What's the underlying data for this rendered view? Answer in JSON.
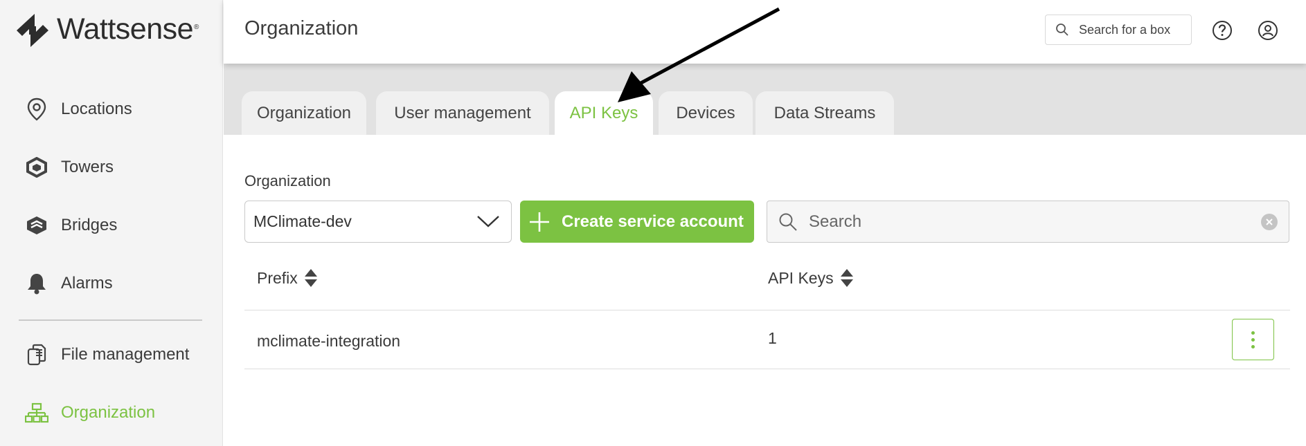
{
  "app": {
    "brand_name": "Wattsense",
    "brand_reg": "®",
    "accent_color": "#7cc242"
  },
  "sidebar": {
    "items": [
      {
        "label": "Locations",
        "icon": "location-pin-icon"
      },
      {
        "label": "Towers",
        "icon": "towers-icon"
      },
      {
        "label": "Bridges",
        "icon": "bridges-icon"
      },
      {
        "label": "Alarms",
        "icon": "bell-icon"
      },
      {
        "label": "File management",
        "icon": "files-icon"
      },
      {
        "label": "Organization",
        "icon": "org-chart-icon",
        "active": true
      }
    ]
  },
  "header": {
    "title": "Organization",
    "box_search_placeholder": "Search for a box",
    "icons": [
      "help-icon",
      "account-icon"
    ]
  },
  "tabs": [
    {
      "label": "Organization"
    },
    {
      "label": "User management"
    },
    {
      "label": "API Keys",
      "active": true
    },
    {
      "label": "Devices"
    },
    {
      "label": "Data Streams"
    }
  ],
  "content": {
    "org_label": "Organization",
    "org_select_value": "MClimate-dev",
    "create_button_label": "Create service account",
    "search_placeholder": "Search",
    "table": {
      "columns": [
        "Prefix",
        "API Keys"
      ],
      "rows": [
        {
          "prefix": "mclimate-integration",
          "api_keys": "1"
        }
      ]
    }
  }
}
